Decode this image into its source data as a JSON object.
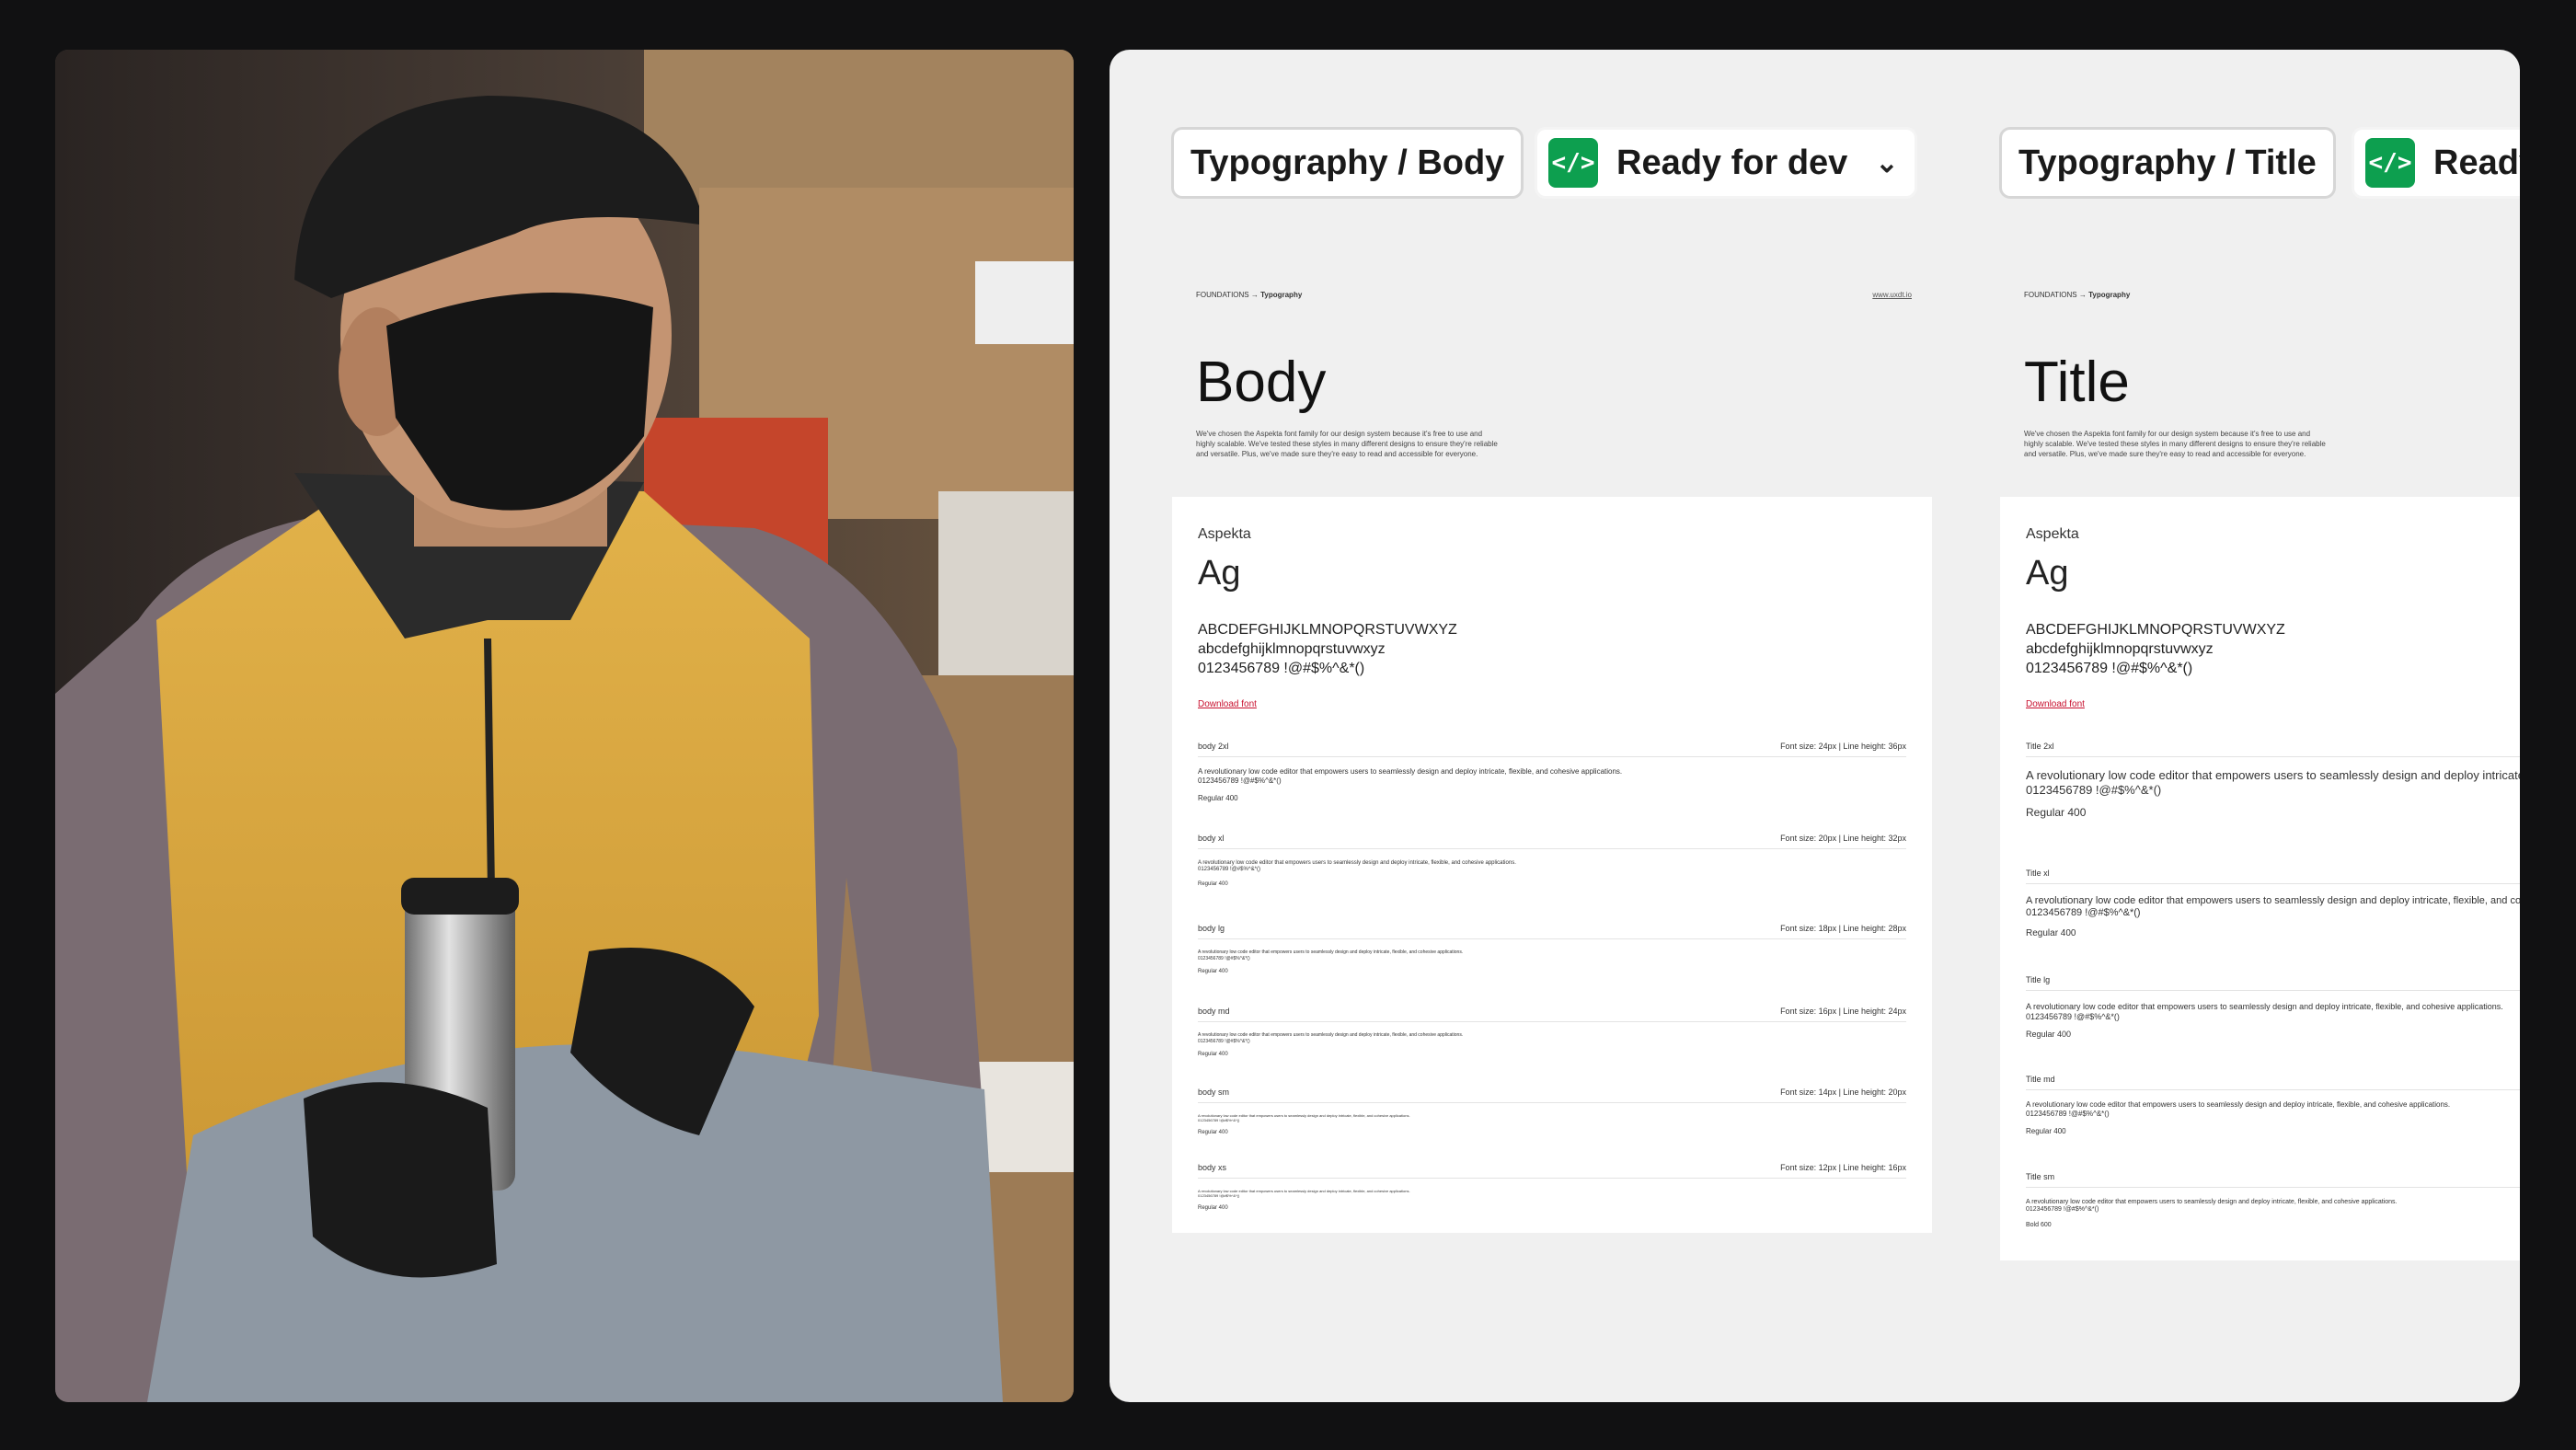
{
  "tags": {
    "body_tag": "Typography / Body",
    "status": "Ready for dev",
    "title_tag": "Typography / Title",
    "status_clipped": "Ready"
  },
  "icons": {
    "dev": "code-icon",
    "dropdown": "chevron-down-icon"
  },
  "colors": {
    "status_green": "#0d9f4f",
    "link_red": "#c8102e",
    "canvas_bg": "#f0f0f0"
  },
  "body_frame": {
    "breadcrumb_a": "FOUNDATIONS",
    "breadcrumb_b": "Typography",
    "weblink": "www.uxdt.io",
    "title": "Body",
    "intro": "We've chosen the Aspekta font family for our design system because it's free to use and highly scalable. We've tested these styles in many different designs to ensure they're reliable and versatile. Plus, we've made sure they're easy to read and accessible for everyone.",
    "font_name": "Aspekta",
    "ag": "Ag",
    "upper": "ABCDEFGHIJKLMNOPQRSTUVWXYZ",
    "lower": "abcdefghijklmnopqrstuvwxyz",
    "digits": "0123456789 !@#$%^&*()",
    "download": "Download font",
    "rows": [
      {
        "name": "body 2xl",
        "meta": "Font size: 24px | Line height: 36px",
        "sample": "A revolutionary low code editor that empowers users to seamlessly design and deploy intricate, flexible, and cohesive applications.",
        "digits": "0123456789 !@#$%^&*()",
        "weight": "Regular 400"
      },
      {
        "name": "body xl",
        "meta": "Font size: 20px | Line height: 32px",
        "sample": "A revolutionary low code editor that empowers users to seamlessly design and deploy intricate, flexible, and cohesive applications.",
        "digits": "0123456789 !@#$%^&*()",
        "weight": "Regular 400"
      },
      {
        "name": "body lg",
        "meta": "Font size: 18px | Line height: 28px",
        "sample": "A revolutionary low code editor that empowers users to seamlessly design and deploy intricate, flexible, and cohesive applications.",
        "digits": "0123456789 !@#$%^&*()",
        "weight": "Regular 400"
      },
      {
        "name": "body md",
        "meta": "Font size: 16px | Line height: 24px",
        "sample": "A revolutionary low code editor that empowers users to seamlessly design and deploy intricate, flexible, and cohesive applications.",
        "digits": "0123456789 !@#$%^&*()",
        "weight": "Regular 400"
      },
      {
        "name": "body sm",
        "meta": "Font size: 14px | Line height: 20px",
        "sample": "A revolutionary low code editor that empowers users to seamlessly design and deploy intricate, flexible, and cohesive applications.",
        "digits": "0123456789 !@#$%^&*()",
        "weight": "Regular 400"
      },
      {
        "name": "body xs",
        "meta": "Font size: 12px | Line height: 16px",
        "sample": "A revolutionary low code editor that empowers users to seamlessly design and deploy intricate, flexible, and cohesive applications.",
        "digits": "0123456789 !@#$%^&*()",
        "weight": "Regular 400"
      }
    ]
  },
  "title_frame": {
    "breadcrumb_a": "FOUNDATIONS",
    "breadcrumb_b": "Typography",
    "title": "Title",
    "intro": "We've chosen the Aspekta font family for our design system because it's free to use and highly scalable. We've tested these styles in many different designs to ensure they're reliable and versatile. Plus, we've made sure they're easy to read and accessible for everyone.",
    "font_name": "Aspekta",
    "ag": "Ag",
    "upper": "ABCDEFGHIJKLMNOPQRSTUVWXYZ",
    "lower": "abcdefghijklmnopqrstuvwxyz",
    "digits": "0123456789 !@#$%^&*()",
    "download": "Download font",
    "rows": [
      {
        "name": "Title 2xl",
        "sample": "A revolutionary low code editor that empowers users to seamlessly design and deploy intricate, flexible, and cohesive applications.",
        "digits": "0123456789 !@#$%^&*()",
        "weight": "Regular 400"
      },
      {
        "name": "Title xl",
        "sample": "A revolutionary low code editor that empowers users to seamlessly design and deploy intricate, flexible, and cohesive applications.",
        "digits": "0123456789 !@#$%^&*()",
        "weight": "Regular 400"
      },
      {
        "name": "Title lg",
        "sample": "A revolutionary low code editor that empowers users to seamlessly design and deploy intricate, flexible, and cohesive applications.",
        "digits": "0123456789 !@#$%^&*()",
        "weight": "Regular 400"
      },
      {
        "name": "Title md",
        "sample": "A revolutionary low code editor that empowers users to seamlessly design and deploy intricate, flexible, and cohesive applications.",
        "digits": "0123456789 !@#$%^&*()",
        "weight": "Regular 400"
      },
      {
        "name": "Title sm",
        "sample": "A revolutionary low code editor that empowers users to seamlessly design and deploy intricate, flexible, and cohesive applications.",
        "digits": "0123456789 !@#$%^&*()",
        "weight": "Bold 600"
      }
    ]
  }
}
